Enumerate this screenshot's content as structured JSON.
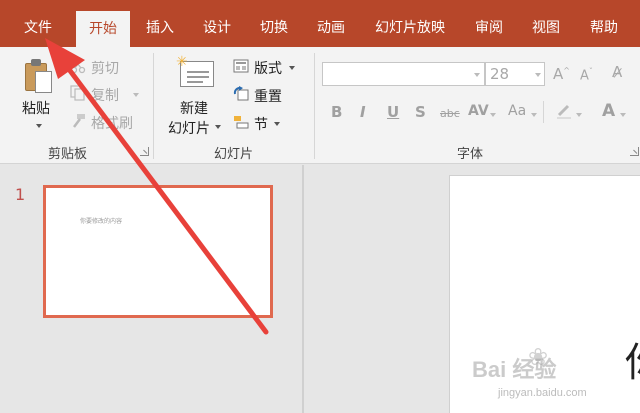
{
  "tabs": [
    {
      "label": "文件",
      "active": false
    },
    {
      "label": "开始",
      "active": true
    },
    {
      "label": "插入",
      "active": false
    },
    {
      "label": "设计",
      "active": false
    },
    {
      "label": "切换",
      "active": false
    },
    {
      "label": "动画",
      "active": false
    },
    {
      "label": "幻灯片放映",
      "active": false
    },
    {
      "label": "审阅",
      "active": false
    },
    {
      "label": "视图",
      "active": false
    },
    {
      "label": "帮助",
      "active": false
    }
  ],
  "clipboard": {
    "group_label": "剪贴板",
    "paste": "粘贴",
    "cut": "剪切",
    "copy": "复制",
    "format_painter": "格式刷"
  },
  "slides_group": {
    "group_label": "幻灯片",
    "new_slide_line1": "新建",
    "new_slide_line2": "幻灯片",
    "layout": "版式",
    "reset": "重置",
    "section": "节"
  },
  "font_group": {
    "group_label": "字体",
    "font_name": "",
    "font_size": "28",
    "buttons": [
      "B",
      "I",
      "U",
      "S",
      "abc",
      "AV",
      "Aa",
      "A"
    ]
  },
  "thumbnails": [
    {
      "number": "1",
      "text": "你要修改的内容"
    }
  ],
  "canvas": {
    "partial_char": "你"
  },
  "watermark": {
    "brand": "Bai 经验",
    "url": "jingyan.baidu.com"
  },
  "colors": {
    "accent": "#b7472a",
    "selection": "#e0694f",
    "arrow": "#e8413a"
  }
}
